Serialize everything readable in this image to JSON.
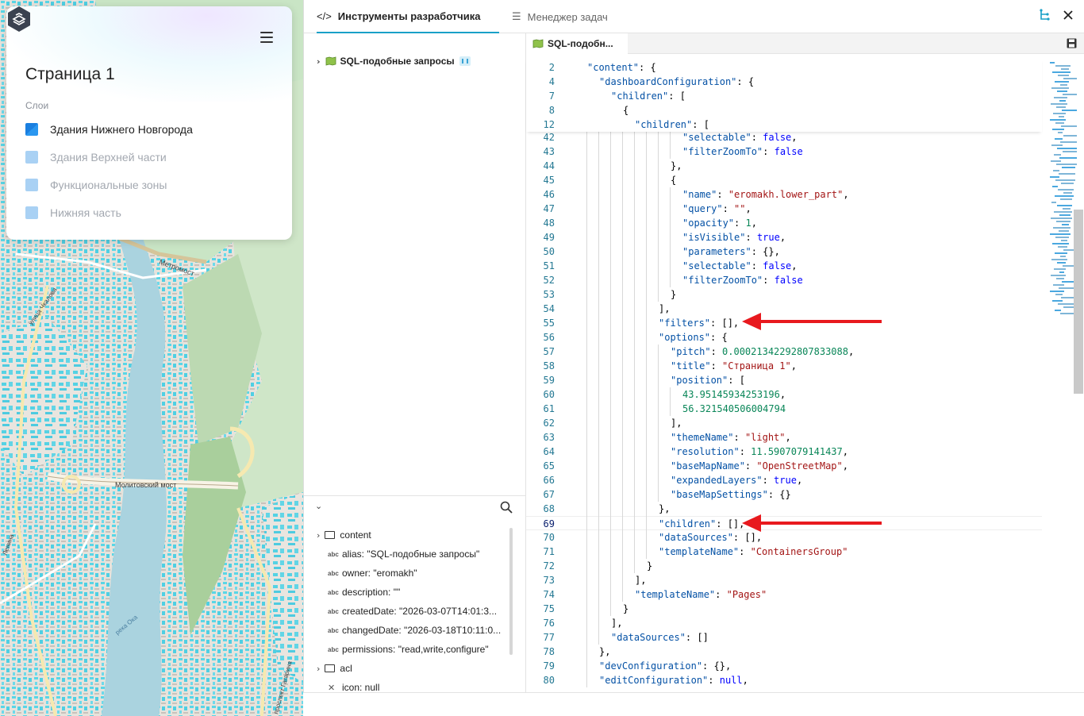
{
  "map_panel": {
    "page_title": "Страница 1",
    "layers_label": "Слои",
    "layers": [
      {
        "label": "Здания Нижнего Новгорода",
        "active": true,
        "color": "#1a7fe0"
      },
      {
        "label": "Здания Верхней части",
        "active": false,
        "color": "#9dcaf2"
      },
      {
        "label": "Функциональные зоны",
        "active": false,
        "color": "#9dcaf2"
      },
      {
        "label": "Нижняя часть",
        "active": false,
        "color": "#9dcaf2"
      }
    ],
    "map_labels": {
      "metro": "Метромост",
      "bridge": "Молитовский мост",
      "street1": "улица Чкалова",
      "street2": "Ленина",
      "street3": "проспект Гагарина",
      "river": "река Ока"
    }
  },
  "devtools": {
    "tabs": [
      {
        "label": "Инструменты разработчика",
        "icon": "code-icon",
        "active": true
      },
      {
        "label": "Менеджер задач",
        "icon": "list-icon",
        "active": false
      }
    ],
    "tree_item": "SQL-подобные запросы",
    "editor_tab": "SQL-подобн...",
    "props": {
      "folder_content": "content",
      "alias": "alias: \"SQL-подобные запросы\"",
      "owner": "owner: \"eromakh\"",
      "description": "description: \"\"",
      "created": "createdDate: \"2026-03-07T14:01:3...",
      "changed": "changedDate: \"2026-03-18T10:11:0...",
      "permissions": "permissions: \"read,write,configure\"",
      "folder_acl": "acl",
      "icon": "icon: null",
      "abc": "abc"
    },
    "sticky_lines": [
      {
        "n": "2",
        "indent": 1,
        "text": "\"content\": {"
      },
      {
        "n": "4",
        "indent": 2,
        "text": "\"dashboardConfiguration\": {"
      },
      {
        "n": "7",
        "indent": 3,
        "text": "\"children\": ["
      },
      {
        "n": "8",
        "indent": 4,
        "text": "{"
      },
      {
        "n": "12",
        "indent": 5,
        "text": "\"children\": ["
      }
    ],
    "code_lines": [
      {
        "n": "42",
        "indent": 9,
        "text": "\"selectable\": false,"
      },
      {
        "n": "43",
        "indent": 9,
        "text": "\"filterZoomTo\": false"
      },
      {
        "n": "44",
        "indent": 8,
        "text": "},"
      },
      {
        "n": "45",
        "indent": 8,
        "text": "{"
      },
      {
        "n": "46",
        "indent": 9,
        "text": "\"name\": \"eromakh.lower_part\","
      },
      {
        "n": "47",
        "indent": 9,
        "text": "\"query\": \"\","
      },
      {
        "n": "48",
        "indent": 9,
        "text": "\"opacity\": 1,"
      },
      {
        "n": "49",
        "indent": 9,
        "text": "\"isVisible\": true,"
      },
      {
        "n": "50",
        "indent": 9,
        "text": "\"parameters\": {},"
      },
      {
        "n": "51",
        "indent": 9,
        "text": "\"selectable\": false,"
      },
      {
        "n": "52",
        "indent": 9,
        "text": "\"filterZoomTo\": false"
      },
      {
        "n": "53",
        "indent": 8,
        "text": "}"
      },
      {
        "n": "54",
        "indent": 7,
        "text": "],"
      },
      {
        "n": "55",
        "indent": 7,
        "text": "\"filters\": [],"
      },
      {
        "n": "56",
        "indent": 7,
        "text": "\"options\": {"
      },
      {
        "n": "57",
        "indent": 8,
        "text": "\"pitch\": 0.00021342292807833088,"
      },
      {
        "n": "58",
        "indent": 8,
        "text": "\"title\": \"Страница 1\","
      },
      {
        "n": "59",
        "indent": 8,
        "text": "\"position\": ["
      },
      {
        "n": "60",
        "indent": 9,
        "text": "43.95145934253196,"
      },
      {
        "n": "61",
        "indent": 9,
        "text": "56.321540506004794"
      },
      {
        "n": "62",
        "indent": 8,
        "text": "],"
      },
      {
        "n": "63",
        "indent": 8,
        "text": "\"themeName\": \"light\","
      },
      {
        "n": "64",
        "indent": 8,
        "text": "\"resolution\": 11.5907079141437,"
      },
      {
        "n": "65",
        "indent": 8,
        "text": "\"baseMapName\": \"OpenStreetMap\","
      },
      {
        "n": "66",
        "indent": 8,
        "text": "\"expandedLayers\": true,"
      },
      {
        "n": "67",
        "indent": 8,
        "text": "\"baseMapSettings\": {}"
      },
      {
        "n": "68",
        "indent": 7,
        "text": "},"
      },
      {
        "n": "69",
        "indent": 7,
        "text": "\"children\": [],"
      },
      {
        "n": "70",
        "indent": 7,
        "text": "\"dataSources\": [],"
      },
      {
        "n": "71",
        "indent": 7,
        "text": "\"templateName\": \"ContainersGroup\""
      },
      {
        "n": "72",
        "indent": 6,
        "text": "}"
      },
      {
        "n": "73",
        "indent": 5,
        "text": "],"
      },
      {
        "n": "74",
        "indent": 5,
        "text": "\"templateName\": \"Pages\""
      },
      {
        "n": "75",
        "indent": 4,
        "text": "}"
      },
      {
        "n": "76",
        "indent": 3,
        "text": "],"
      },
      {
        "n": "77",
        "indent": 3,
        "text": "\"dataSources\": []"
      },
      {
        "n": "78",
        "indent": 2,
        "text": "},"
      },
      {
        "n": "79",
        "indent": 2,
        "text": "\"devConfiguration\": {},"
      },
      {
        "n": "80",
        "indent": 2,
        "text": "\"editConfiguration\": null,"
      }
    ],
    "current_line": "69",
    "colors": {
      "accent": "#19a0c7",
      "arrow": "#e8191e",
      "key": "#0451a5",
      "string": "#a31515",
      "number": "#098658"
    }
  }
}
